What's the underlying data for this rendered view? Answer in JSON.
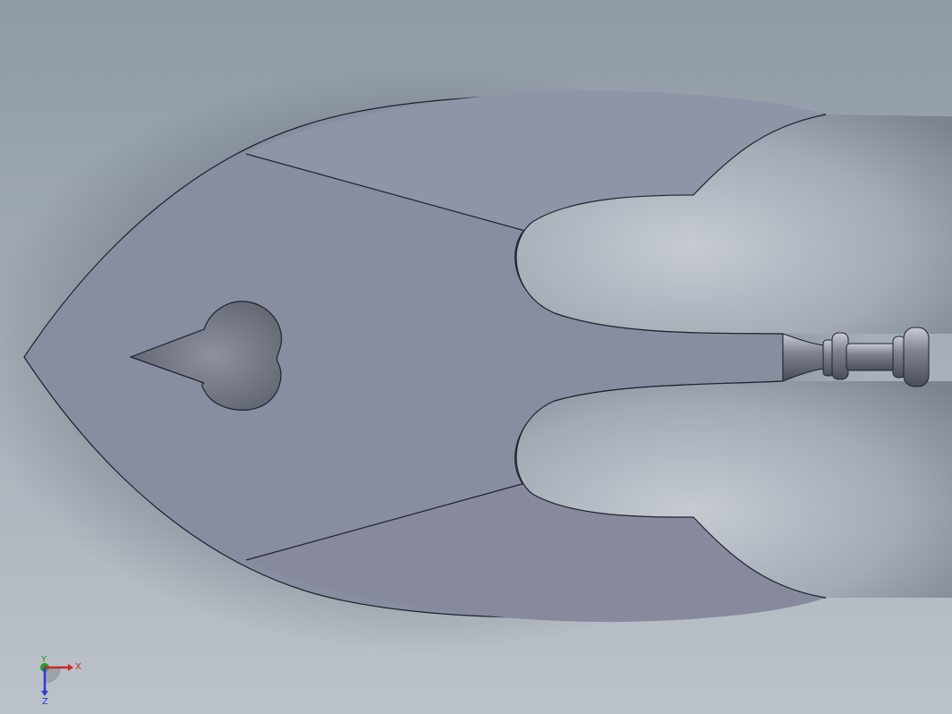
{
  "viewport": {
    "background_top": "#8e9aa6",
    "background_bottom": "#bcc2c9"
  },
  "model": {
    "face_color": "#8a8ea0",
    "face_color_light": "#9094a8",
    "edge_color": "#1e2230",
    "hole_color": "#6e7280",
    "handle_color": "#7e8290"
  },
  "triad": {
    "x_label": "X",
    "y_label": "Y",
    "z_label": "Z",
    "x_color": "#c8282a",
    "y_color": "#2a9a2a",
    "z_color": "#2a3ad8"
  }
}
